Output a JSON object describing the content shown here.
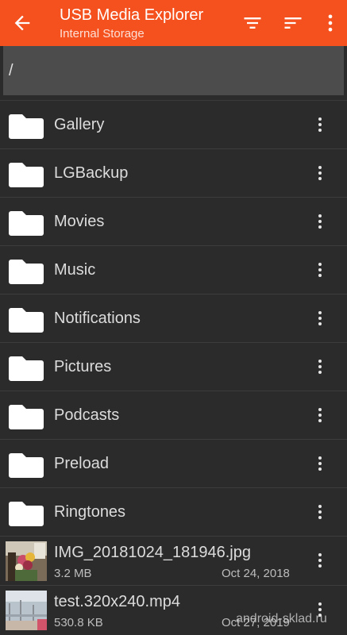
{
  "app_bar": {
    "title": "USB Media Explorer",
    "subtitle": "Internal Storage",
    "background": "#f4511e",
    "icons": [
      "back-arrow-icon",
      "filter-icon",
      "sort-icon",
      "more-vert-icon"
    ]
  },
  "path": {
    "current": "/"
  },
  "folders": [
    {
      "name": "Gallery"
    },
    {
      "name": "LGBackup"
    },
    {
      "name": "Movies"
    },
    {
      "name": "Music"
    },
    {
      "name": "Notifications"
    },
    {
      "name": "Pictures"
    },
    {
      "name": "Podcasts"
    },
    {
      "name": "Preload"
    },
    {
      "name": "Ringtones"
    }
  ],
  "files": [
    {
      "name": "IMG_20181024_181946.jpg",
      "size": "3.2 MB",
      "date": "Oct 24, 2018",
      "thumbnail": "photo-flowers"
    },
    {
      "name": "test.320x240.mp4",
      "size": "530.8 KB",
      "date": "Oct 27, 2019",
      "thumbnail": "video-frame"
    }
  ],
  "watermark": "android-sklad.ru"
}
